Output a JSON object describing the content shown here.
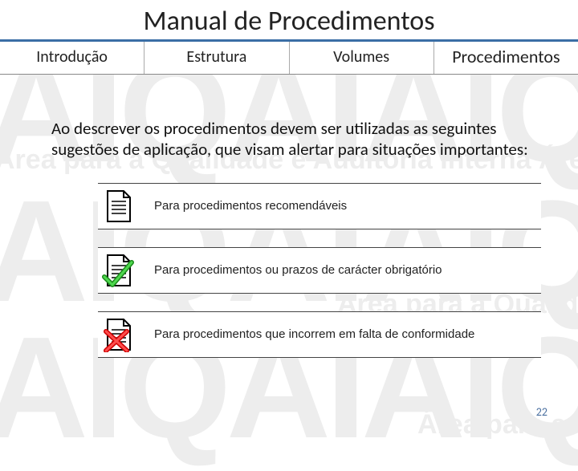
{
  "title": "Manual de Procedimentos",
  "tabs": [
    {
      "label": "Introdução",
      "active": false
    },
    {
      "label": "Estrutura",
      "active": false
    },
    {
      "label": "Volumes",
      "active": false
    },
    {
      "label": "Procedimentos",
      "active": true
    }
  ],
  "intro": "Ao descrever os procedimentos devem ser utilizadas as seguintes sugestões de aplicação, que visam alertar para situações importantes:",
  "items": [
    {
      "icon": "doc",
      "text": "Para procedimentos recomendáveis"
    },
    {
      "icon": "doc-check",
      "text": "Para procedimentos ou prazos de carácter obrigatório"
    },
    {
      "icon": "doc-cross",
      "text": "Para procedimentos que incorrem em falta de conformidade"
    }
  ],
  "page_number": "22",
  "watermark": {
    "big": "AIQAIAIQ",
    "mid": "Área para a Qualidade e Auditoria Interna       Área para a Quali"
  }
}
